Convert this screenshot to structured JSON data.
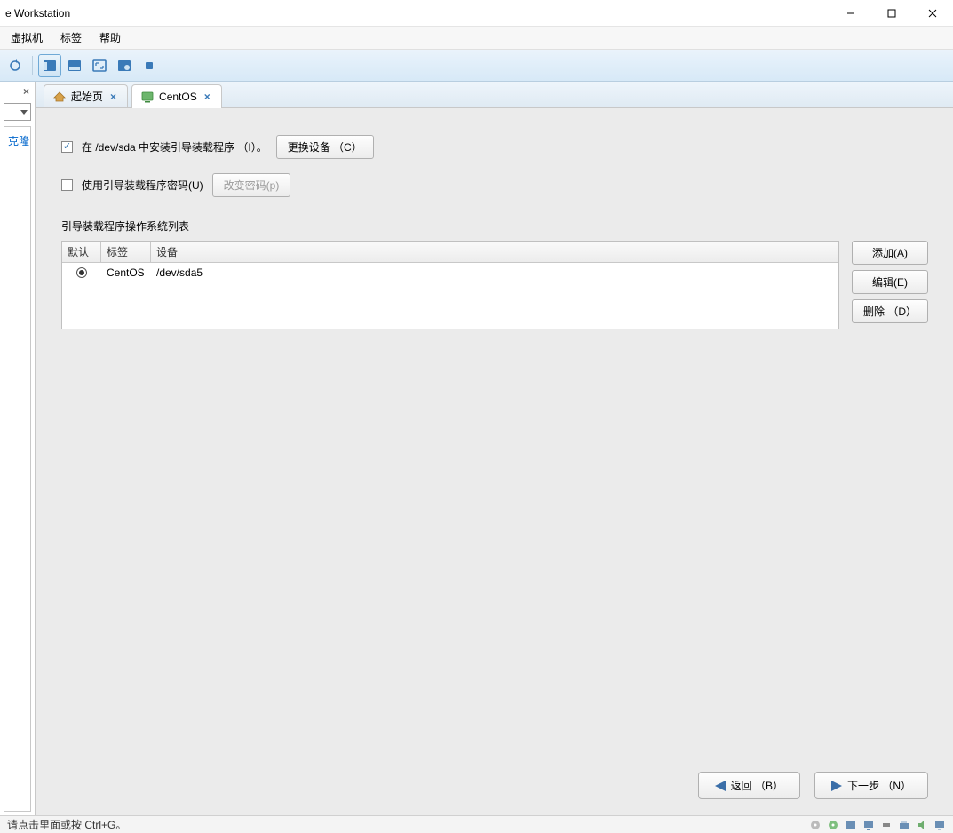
{
  "window": {
    "title": "e Workstation"
  },
  "menubar": {
    "items": [
      "虚拟机",
      "标签",
      "帮助"
    ]
  },
  "leftpanel": {
    "entry": "克隆"
  },
  "tabs": {
    "home": "起始页",
    "centos": "CentOS"
  },
  "installer": {
    "check_install_boot": "在 /dev/sda 中安装引导装载程序 （I）。",
    "btn_change_device": "更换设备 （C）",
    "check_use_password": "使用引导装载程序密码(U)",
    "btn_change_password": "改变密码(p)",
    "section_title": "引导装载程序操作系统列表",
    "table": {
      "headers": {
        "default": "默认",
        "label": "标签",
        "device": "设备"
      },
      "rows": [
        {
          "default": true,
          "label": "CentOS",
          "device": "/dev/sda5"
        }
      ]
    },
    "side_buttons": {
      "add": "添加(A)",
      "edit": "编辑(E)",
      "delete": "删除 （D）"
    },
    "nav": {
      "back": "返回 （B）",
      "next": "下一步 （N）"
    }
  },
  "statusbar": {
    "hint": "请点击里面或按 Ctrl+G。"
  }
}
